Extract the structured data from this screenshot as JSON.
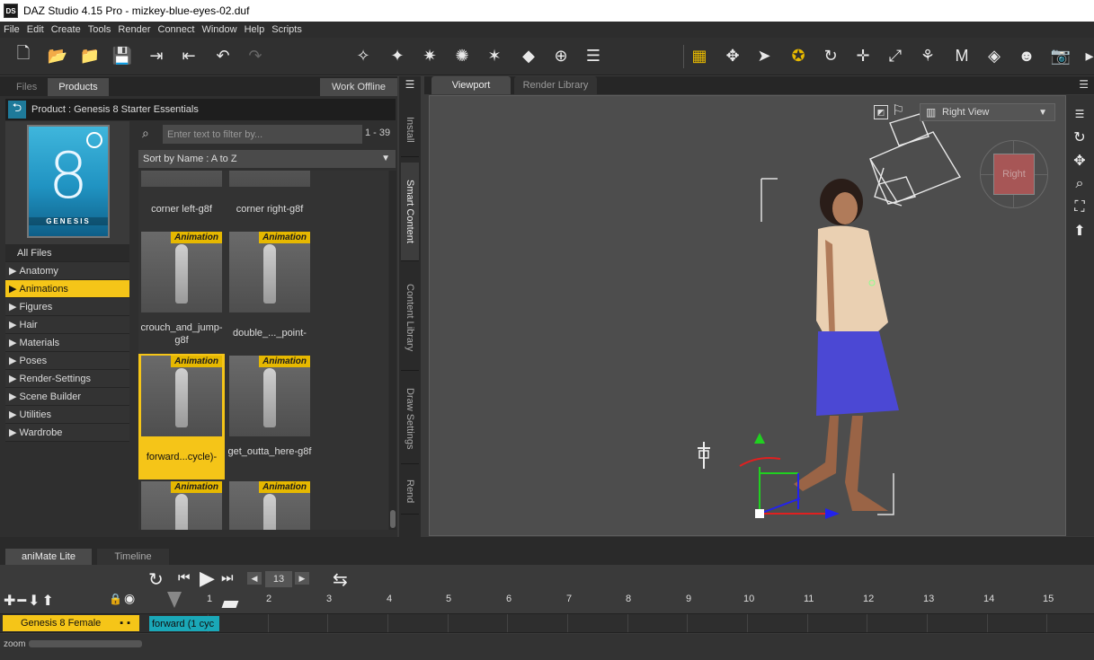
{
  "window": {
    "title": "DAZ Studio 4.15 Pro - mizkey-blue-eyes-02.duf",
    "app_icon": "DS"
  },
  "menu": [
    "File",
    "Edit",
    "Create",
    "Tools",
    "Render",
    "Connect",
    "Window",
    "Help",
    "Scripts"
  ],
  "left_panel": {
    "tabs": [
      "Files",
      "Products"
    ],
    "active_tab": "Products",
    "work_offline": "Work Offline",
    "product_label": "Product :  Genesis 8 Starter Essentials",
    "product_thumb_text": "GENESIS",
    "product_thumb_numeral": "8",
    "categories": [
      {
        "label": "All Files",
        "selected": false,
        "expander": false
      },
      {
        "label": "Anatomy",
        "selected": false,
        "expander": true
      },
      {
        "label": "Animations",
        "selected": true,
        "expander": true
      },
      {
        "label": "Figures",
        "selected": false,
        "expander": true
      },
      {
        "label": "Hair",
        "selected": false,
        "expander": true
      },
      {
        "label": "Materials",
        "selected": false,
        "expander": true
      },
      {
        "label": "Poses",
        "selected": false,
        "expander": true
      },
      {
        "label": "Render-Settings",
        "selected": false,
        "expander": true
      },
      {
        "label": "Scene Builder",
        "selected": false,
        "expander": true
      },
      {
        "label": "Utilities",
        "selected": false,
        "expander": true
      },
      {
        "label": "Wardrobe",
        "selected": false,
        "expander": true
      }
    ],
    "filter_placeholder": "Enter text to filter by...",
    "count": "1 - 39",
    "sort": "Sort by Name : A to Z",
    "badge": "Animation",
    "items": [
      {
        "name": "corner left-g8f"
      },
      {
        "name": "corner right-g8f"
      },
      {
        "name": "crouch_and_jump-g8f"
      },
      {
        "name": "double_..._point-"
      },
      {
        "name": "forward...cycle)-"
      },
      {
        "name": "get_outta_here-g8f"
      },
      {
        "name": ""
      },
      {
        "name": ""
      }
    ],
    "side_tabs": [
      "Install",
      "Smart Content",
      "Content Library",
      "Draw Settings",
      "Rend"
    ]
  },
  "viewport": {
    "tabs": [
      "Viewport",
      "Render Library"
    ],
    "active_tab": "Viewport",
    "view_select": "Right View",
    "cube_label": "Right"
  },
  "timeline": {
    "tabs": [
      "aniMate Lite",
      "Timeline"
    ],
    "active_tab": "aniMate Lite",
    "frame": "13",
    "ruler": [
      "1",
      "2",
      "3",
      "4",
      "5",
      "6",
      "7",
      "8",
      "9",
      "10",
      "11",
      "12",
      "13",
      "14",
      "15"
    ],
    "figure": "Genesis 8 Female",
    "clip": "forward (1 cyc",
    "zoom_label": "zoom"
  },
  "colors": {
    "accent_yellow": "#f5c518",
    "clip_teal": "#1aa8b8",
    "badge": "#e6b800"
  }
}
